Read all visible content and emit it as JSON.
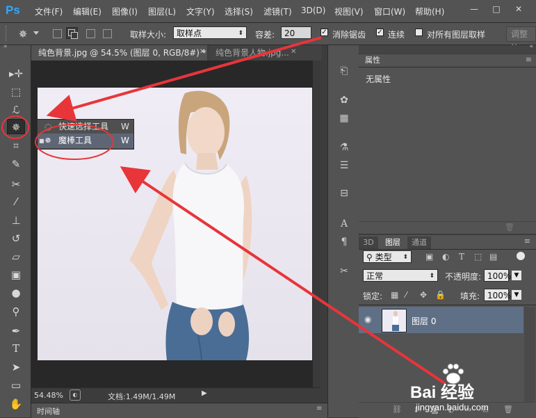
{
  "app": {
    "logo": "Ps",
    "menu": [
      "文件(F)",
      "编辑(E)",
      "图像(I)",
      "图层(L)",
      "文字(Y)",
      "选择(S)",
      "滤镜(T)",
      "3D(D)",
      "视图(V)",
      "窗口(W)",
      "帮助(H)"
    ],
    "window_buttons": [
      "—",
      "□",
      "✕"
    ]
  },
  "options": {
    "sample_size_label": "取样大小:",
    "sample_size_value": "取样点",
    "tolerance_label": "容差:",
    "tolerance_value": "20",
    "anti_alias": {
      "label": "消除锯齿",
      "checked": true
    },
    "contiguous": {
      "label": "连续",
      "checked": true
    },
    "sample_all": {
      "label": "对所有图层取样",
      "checked": false
    },
    "refine_edge": "调整边"
  },
  "tabs": [
    {
      "label": "纯色背景.jpg @ 54.5% (图层 0, RGB/8#) *",
      "active": true
    },
    {
      "label": "纯色背景人物.jpg...",
      "active": false
    }
  ],
  "flyout": {
    "items": [
      {
        "label": "快速选择工具",
        "shortcut": "W",
        "selected": false
      },
      {
        "label": "魔棒工具",
        "shortcut": "W",
        "selected": true
      }
    ]
  },
  "status": {
    "zoom": "54.48%",
    "doc_info": "文档:1.49M/1.49M"
  },
  "timeline": {
    "label": "时间轴"
  },
  "properties": {
    "tab": "属性",
    "content": "无属性"
  },
  "layers": {
    "tabs": [
      "3D",
      "图层",
      "通道"
    ],
    "active_tab": "图层",
    "filter_kind": "类型",
    "blend_mode": "正常",
    "opacity_label": "不透明度:",
    "opacity_value": "100%",
    "lock_label": "锁定:",
    "fill_label": "填充:",
    "fill_value": "100%",
    "items": [
      {
        "name": "图层 0",
        "visible": true
      }
    ],
    "footer_icons": [
      "link-icon",
      "fx-icon",
      "mask-icon",
      "adjustment-icon",
      "group-icon",
      "new-layer-icon",
      "trash-icon"
    ],
    "fx_label": "fx"
  },
  "watermark": {
    "brand": "Bai 经验",
    "url": "jingyan.baidu.com"
  },
  "colors": {
    "accent_red": "#e8353a",
    "ps_blue": "#31a8ff",
    "panel_bg": "#535353",
    "selected_layer": "#5f6f86"
  }
}
